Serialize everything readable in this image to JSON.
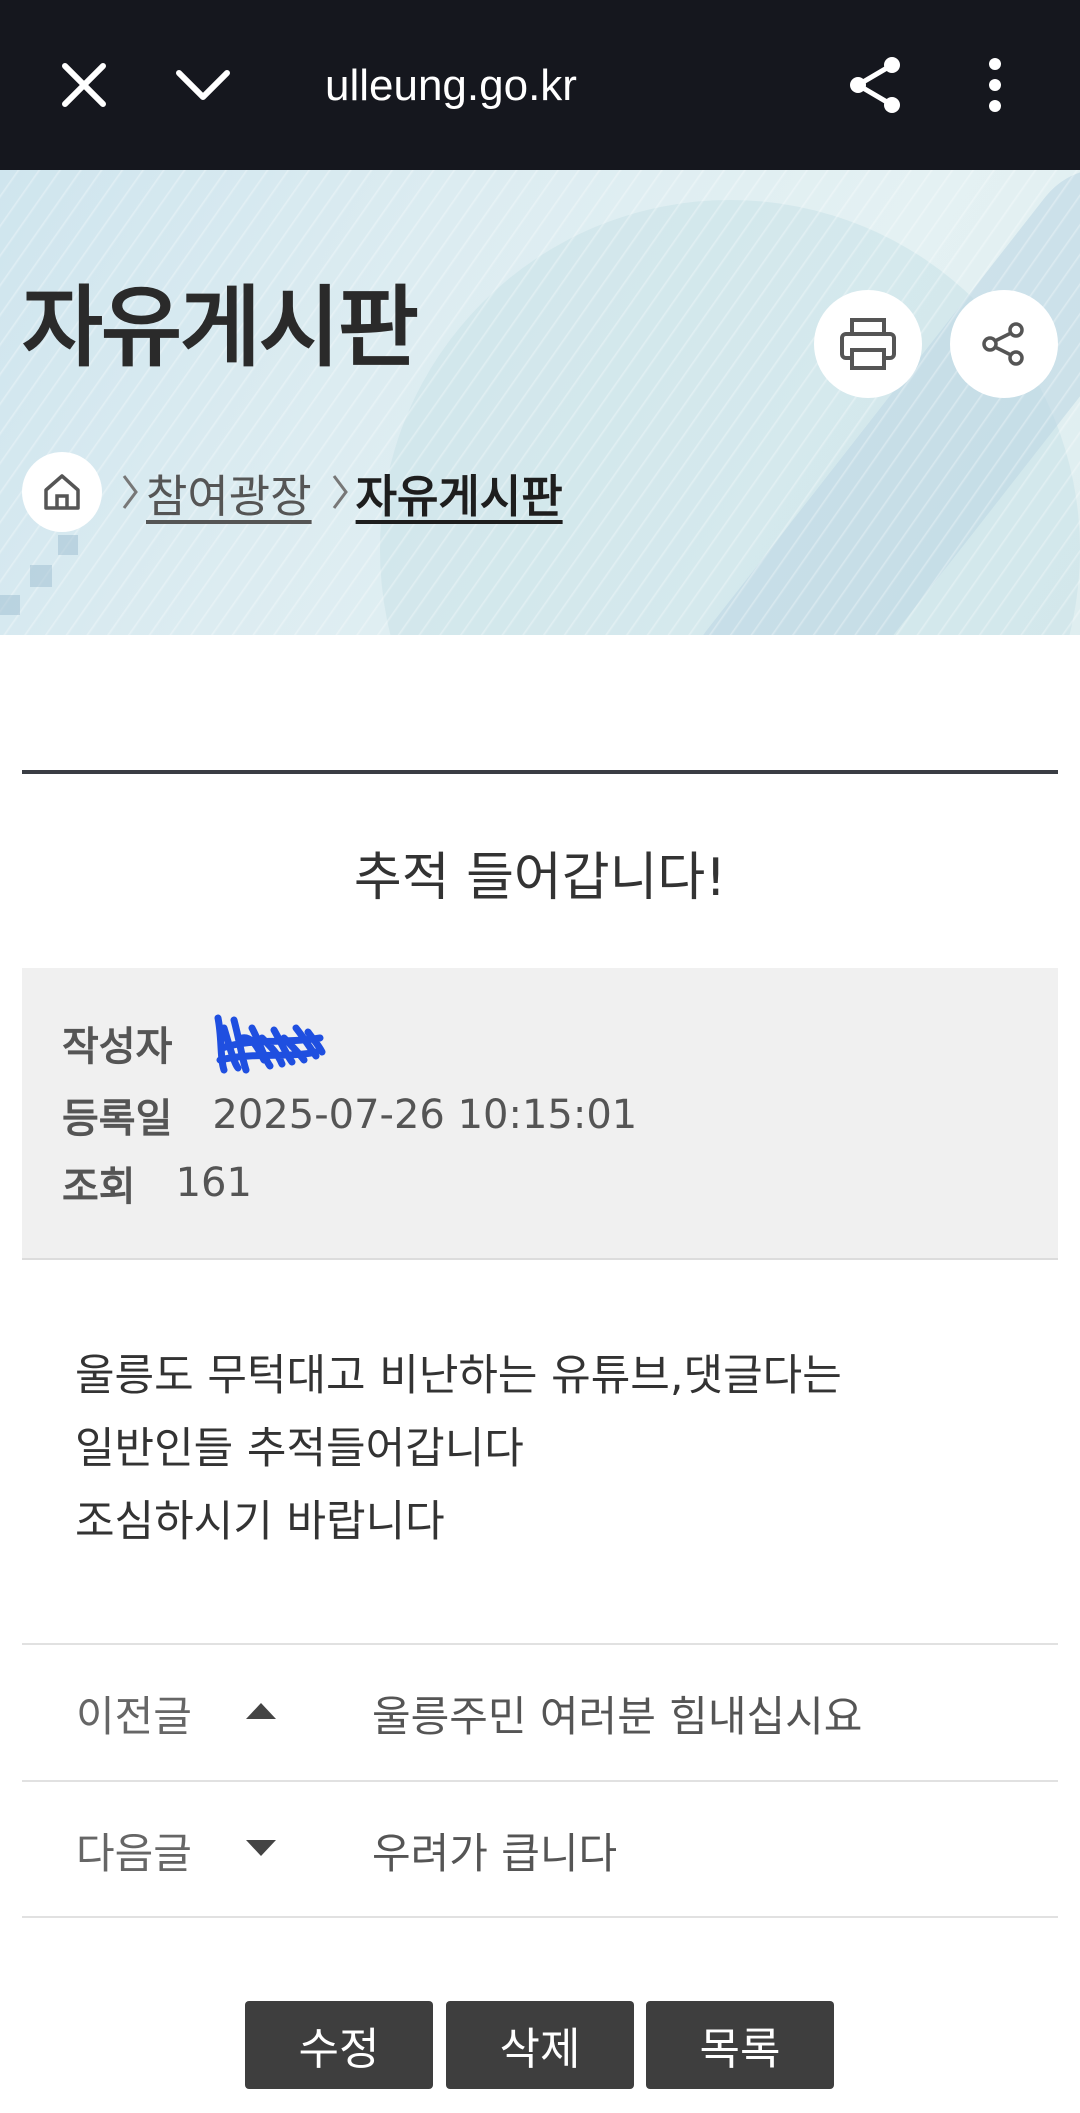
{
  "browser": {
    "url": "ulleung.go.kr",
    "icons": [
      "close-icon",
      "chevron-down-icon",
      "share-icon",
      "more-vertical-icon"
    ]
  },
  "header": {
    "title": "자유게시판",
    "breadcrumb": [
      "참여광장",
      "자유게시판"
    ],
    "icons": [
      "print-icon",
      "share-icon",
      "home-icon"
    ]
  },
  "post": {
    "title": "추적 들어갑니다!",
    "author_label": "작성자",
    "date_label": "등록일",
    "date": "2025-07-26 10:15:01",
    "views_label": "조회",
    "views": "161",
    "body": [
      "울릉도 무턱대고 비난하는 유튜브,댓글다는",
      "일반인들 추적들어갑니다",
      "조심하시기 바랍니다"
    ]
  },
  "navigation": {
    "prev_label": "이전글",
    "prev_title": "울릉주민 여러분 힘내십시요",
    "next_label": "다음글",
    "next_title": "우려가 큽니다"
  },
  "actions": {
    "edit": "수정",
    "delete": "삭제",
    "list": "목록"
  },
  "colors": {
    "topbar": "#15171e",
    "button": "#3e3e3e",
    "redaction": "#1f4fe0"
  }
}
